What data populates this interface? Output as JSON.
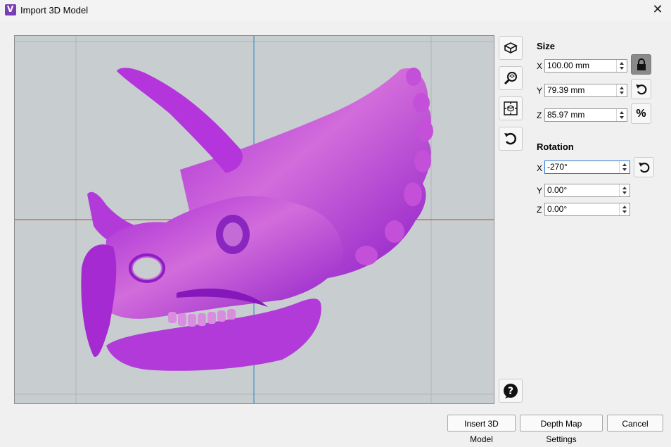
{
  "window": {
    "title": "Import 3D Model",
    "close_glyph": "✕"
  },
  "size": {
    "header": "Size",
    "x_label": "X",
    "x_value": "100.00 mm",
    "y_label": "Y",
    "y_value": "79.39 mm",
    "z_label": "Z",
    "z_value": "85.97 mm",
    "lock_icon": "lock-icon",
    "percent_label": "%"
  },
  "rotation": {
    "header": "Rotation",
    "x_label": "X",
    "x_value": "-270°",
    "y_label": "Y",
    "y_value": "0.00°",
    "z_label": "Z",
    "z_value": "0.00°"
  },
  "toolbar": {
    "tools": [
      "view-orientation-icon",
      "zoom-fit-icon",
      "fit-to-box-icon",
      "reset-view-icon"
    ],
    "help_icon": "help-icon"
  },
  "buttons": {
    "insert": "Insert 3D Model",
    "depth": "Depth Map Settings",
    "cancel": "Cancel"
  },
  "colors": {
    "model": "#b52fe0",
    "viewport_bg": "#c8cdd0",
    "axis_x": "#d03a2a",
    "axis_y": "#2a86c9"
  }
}
